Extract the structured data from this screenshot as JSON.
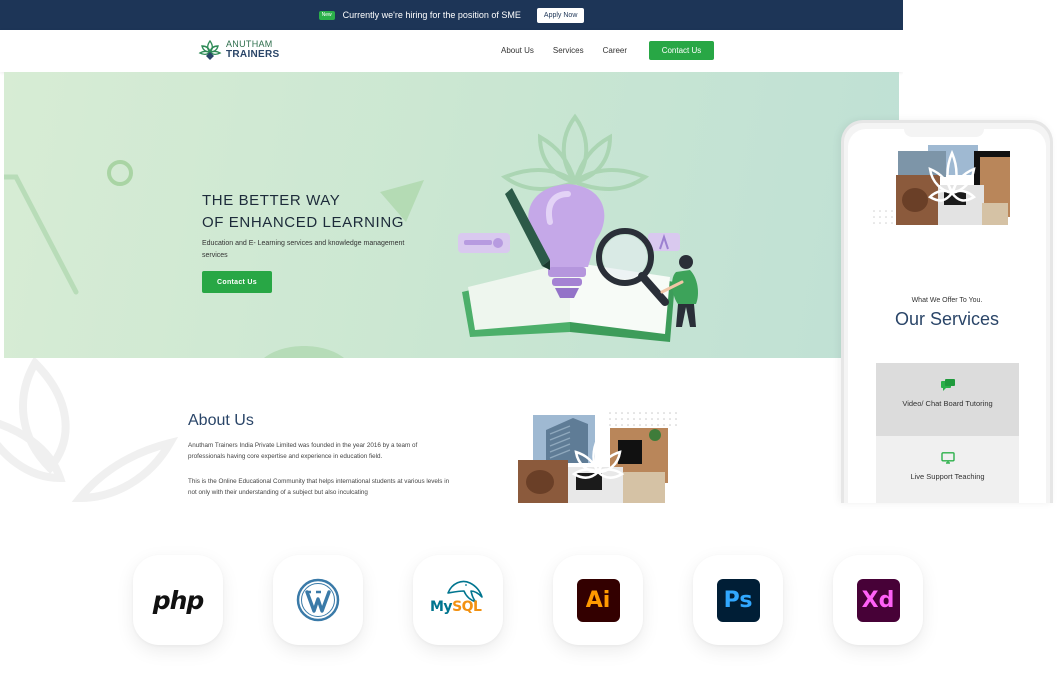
{
  "topbar": {
    "badge": "New",
    "message": "Currently we're hiring for the position of SME",
    "apply_label": "Apply Now"
  },
  "brand": {
    "line1": "ANUTHAM",
    "line2": "TRAINERS",
    "icon": "lotus-logo-icon"
  },
  "nav": {
    "items": [
      {
        "label": "About Us"
      },
      {
        "label": "Services"
      },
      {
        "label": "Career"
      }
    ],
    "contact_label": "Contact Us"
  },
  "hero": {
    "title_line1": "THE BETTER WAY",
    "title_line2": "OF ENHANCED LEARNING",
    "subtitle": "Education and E- Learning services and knowledge management services",
    "button_label": "Contact Us"
  },
  "about": {
    "title": "About Us",
    "paragraph1": "Anutham Trainers India Private Limited was founded in the year 2016 by a team of professionals having core expertise and experience in education field.",
    "paragraph2": "This is the Online Educational Community that helps international students at various levels in not only with their understanding of a subject but also inculcating"
  },
  "mobile": {
    "subtitle": "What We Offer To You.",
    "title": "Our Services",
    "cards": [
      {
        "label": "Video/ Chat Board Tutoring",
        "icon": "chat-icon"
      },
      {
        "label": "Live Support Teaching",
        "icon": "monitor-icon"
      }
    ]
  },
  "tech": {
    "php": "php",
    "wordpress_icon": "wordpress-icon",
    "mysql_my": "My",
    "mysql_sql": "SQL",
    "illustrator": "Ai",
    "photoshop": "Ps",
    "xd": "Xd"
  },
  "colors": {
    "navy": "#1d3557",
    "green": "#28a745",
    "hero_bg": "#d7ecd4",
    "heading": "#2a4568"
  }
}
